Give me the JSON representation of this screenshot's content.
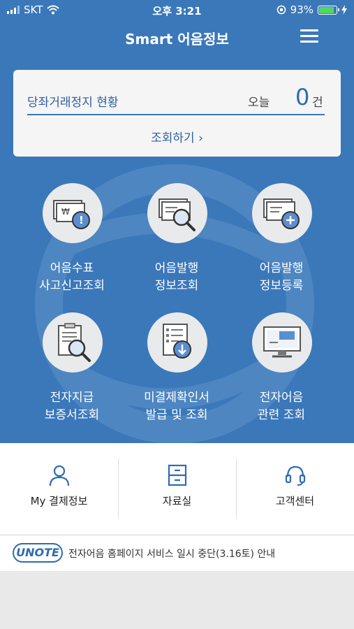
{
  "status_bar": {
    "carrier": "SKT",
    "time": "오후 3:21",
    "battery": "93%"
  },
  "header": {
    "title": "Smart 어음정보",
    "menu_icon": "hamburger-menu-icon"
  },
  "status_card": {
    "label": "당좌거래정지 현황",
    "today_label": "오늘",
    "count": "0",
    "unit": "건",
    "link": "조회하기 ›"
  },
  "menu": {
    "items": [
      {
        "line1": "어음수표",
        "line2": "사고신고조회",
        "icon": "warning-check-icon"
      },
      {
        "line1": "어음발행",
        "line2": "정보조회",
        "icon": "document-search-icon"
      },
      {
        "line1": "어음발행",
        "line2": "정보등록",
        "icon": "document-add-icon"
      },
      {
        "line1": "전자지급",
        "line2": "보증서조회",
        "icon": "clipboard-search-icon"
      },
      {
        "line1": "미결제확인서",
        "line2": "발급 및 조회",
        "icon": "document-download-icon"
      },
      {
        "line1": "전자어음",
        "line2": "관련 조회",
        "icon": "monitor-icon"
      }
    ]
  },
  "quick_links": [
    {
      "label": "My 결제정보",
      "icon": "person-icon"
    },
    {
      "label": "자료실",
      "icon": "archive-icon"
    },
    {
      "label": "고객센터",
      "icon": "headset-icon"
    }
  ],
  "notice": {
    "logo": "UNOTE",
    "text": "전자어음 홈페이지 서비스 일시 중단(3.16토) 안내"
  },
  "colors": {
    "primary_blue": "#3a78ba",
    "link_blue": "#2f5f9e",
    "battery_green": "#4cd964"
  }
}
